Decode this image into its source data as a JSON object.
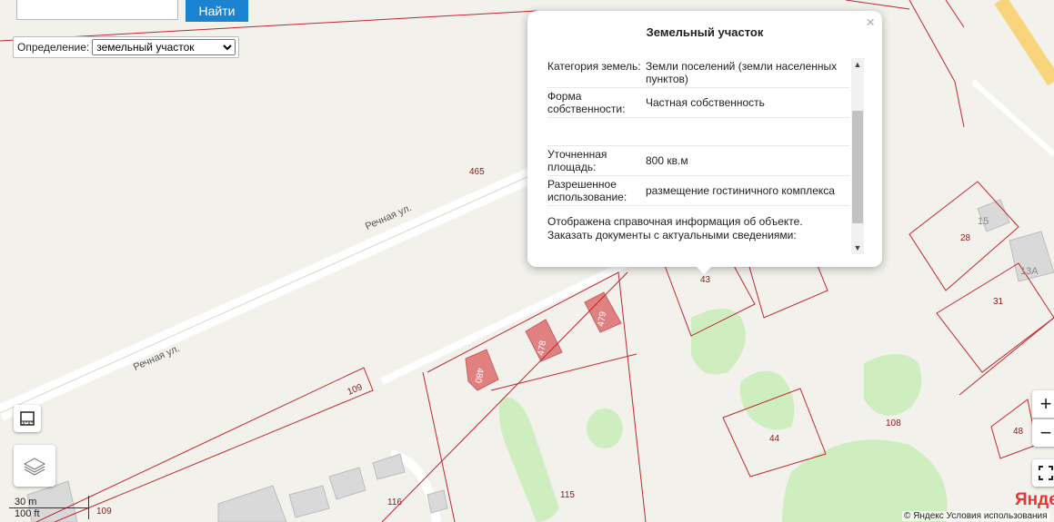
{
  "search": {
    "placeholder": "",
    "button_label": "Найти"
  },
  "definition": {
    "label": "Определение:",
    "selected": "земельный участок"
  },
  "popup": {
    "title": "Земельный участок",
    "close_glyph": "×",
    "rows": [
      {
        "key": "Категория земель:",
        "value": "Земли поселений (земли населенных пунктов)"
      },
      {
        "key": "Форма собственности:",
        "value": "Частная собственность"
      },
      {
        "key": "",
        "value": ""
      },
      {
        "key": "Уточненная площадь:",
        "value": "800 кв.м"
      },
      {
        "key": "Разрешенное использование:",
        "value": "размещение гостиничного комплекса"
      }
    ],
    "note": "Отображена справочная информация об объекте. Заказать документы с актуальными сведениями:"
  },
  "map": {
    "streets": [
      "Речная ул.",
      "Речная ул."
    ],
    "parcels": [
      "465",
      "109",
      "109",
      "116",
      "115",
      "108",
      "44",
      "43",
      "31",
      "28",
      "48"
    ],
    "buildings": [
      "480",
      "478",
      "479",
      "15",
      "13А"
    ]
  },
  "controls": {
    "zoom_in": "+",
    "zoom_out": "−"
  },
  "scale": {
    "metric": "30 m",
    "imperial": "100 ft"
  },
  "copyright": "© Яндекс  Условия использования",
  "logo": "Яндекс",
  "colors": {
    "parcel_line": "#c0272d",
    "building": "#e08080",
    "greenery": "#cfeec0",
    "road": "#ffffff",
    "highway": "#f8d57a",
    "button": "#1b84d2"
  }
}
